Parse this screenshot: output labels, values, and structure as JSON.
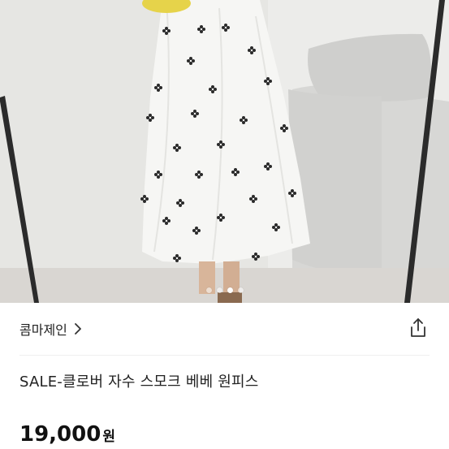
{
  "product": {
    "image_alt": "flower embroidered smocked dress mirror photo",
    "carousel": {
      "count": 4,
      "active_index": 2
    }
  },
  "seller": {
    "name": "콤마제인",
    "chevron_icon": "chevron-right-icon"
  },
  "share_icon": "share-icon",
  "listing": {
    "title": "SALE-클로버 자수 스모크 베베 원피스",
    "price": "19,000",
    "currency": "원"
  },
  "colors": {
    "text": "#222222",
    "divider": "#efefef"
  }
}
